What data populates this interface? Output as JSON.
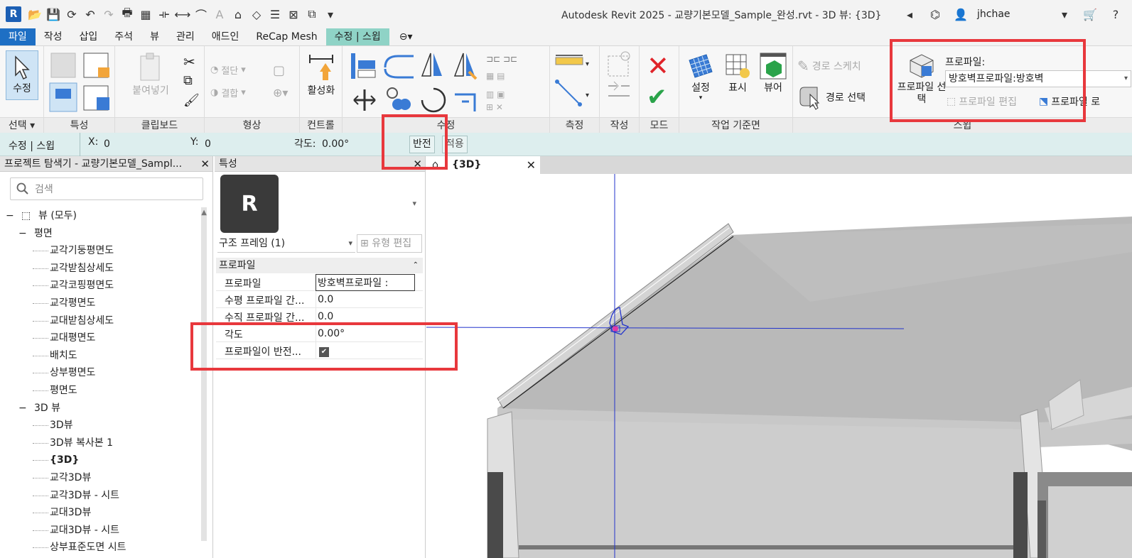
{
  "app": {
    "logo": "R",
    "title": "Autodesk Revit 2025 - 교량기본모델_Sample_완성.rvt - 3D 뷰: {3D}",
    "user": "jhchae"
  },
  "tabs": [
    {
      "label": "파일"
    },
    {
      "label": "작성"
    },
    {
      "label": "삽입"
    },
    {
      "label": "주석"
    },
    {
      "label": "뷰"
    },
    {
      "label": "관리"
    },
    {
      "label": "애드인"
    },
    {
      "label": "ReCap Mesh"
    },
    {
      "label": "수정 | 스윕"
    }
  ],
  "ribbon": {
    "select": {
      "modify": "수정",
      "label": "선택"
    },
    "properties_label": "특성",
    "clipboard": {
      "paste": "붙여넣기",
      "label": "클립보드"
    },
    "geometry": {
      "cut": "절단",
      "join": "결합",
      "label": "형상"
    },
    "control": {
      "activate": "활성화",
      "label": "컨트롤"
    },
    "modify_label": "수정",
    "measure_label": "측정",
    "create_label": "작성",
    "mode_label": "모드",
    "workplane": {
      "set": "설정",
      "show": "표시",
      "viewer": "뷰어",
      "label": "작업 기준면"
    },
    "sweep": {
      "sketch_path": "경로 스케치",
      "pick_path": "경로 선택",
      "pick_profile": "프로파일 선택",
      "profile_caption": "프로파일:",
      "profile_value": "방호벽프로파일:방호벽",
      "edit_profile": "프로파일 편집",
      "load_profile": "프로파일 로",
      "label": "스윕"
    }
  },
  "options_bar": {
    "context": "수정 | 스윕",
    "x_label": "X:",
    "x_value": "0",
    "y_label": "Y:",
    "y_value": "0",
    "angle_label": "각도:",
    "angle_value": "0.00°",
    "flip": "반전",
    "apply": "적용"
  },
  "project_browser": {
    "title": "프로젝트 탐색기 - 교량기본모델_Sampl...",
    "search_placeholder": "검색",
    "tree": [
      {
        "text": "뷰 (모두)",
        "level": 0,
        "toggle": "−"
      },
      {
        "text": "평면",
        "level": 1,
        "toggle": "−"
      },
      {
        "text": "교각기둥평면도",
        "level": 2
      },
      {
        "text": "교각받침상세도",
        "level": 2
      },
      {
        "text": "교각코핑평면도",
        "level": 2
      },
      {
        "text": "교각평면도",
        "level": 2
      },
      {
        "text": "교대받침상세도",
        "level": 2
      },
      {
        "text": "교대평면도",
        "level": 2
      },
      {
        "text": "배치도",
        "level": 2
      },
      {
        "text": "상부평면도",
        "level": 2
      },
      {
        "text": "평면도",
        "level": 2
      },
      {
        "text": "3D 뷰",
        "level": 1,
        "toggle": "−"
      },
      {
        "text": "3D뷰",
        "level": 2
      },
      {
        "text": "3D뷰 복사본 1",
        "level": 2
      },
      {
        "text": "{3D}",
        "level": 2,
        "bold": true
      },
      {
        "text": "교각3D뷰",
        "level": 2
      },
      {
        "text": "교각3D뷰 - 시트",
        "level": 2
      },
      {
        "text": "교대3D뷰",
        "level": 2
      },
      {
        "text": "교대3D뷰 - 시트",
        "level": 2
      },
      {
        "text": "상부표준도면 시트",
        "level": 2
      }
    ]
  },
  "properties": {
    "title": "특성",
    "thumb_letter": "R",
    "filter": "구조 프레임 (1)",
    "edit_type": "유형 편집",
    "section": "프로파일",
    "rows": [
      {
        "name": "프로파일",
        "value": "방호벽프로파일 :"
      },
      {
        "name": "수평 프로파일 간...",
        "value": "0.0"
      },
      {
        "name": "수직 프로파일 간...",
        "value": "0.0"
      },
      {
        "name": "각도",
        "value": "0.00°"
      },
      {
        "name": "프로파일이 반전...",
        "value": "✔"
      }
    ]
  },
  "view": {
    "tab": "{3D}"
  },
  "colors": {
    "file_tab": "#1e6fc4",
    "context_tab": "#8fd3c6",
    "options_bar": "#ddeeee",
    "annotation": "#e8383d",
    "work_axis": "#2233cc"
  }
}
